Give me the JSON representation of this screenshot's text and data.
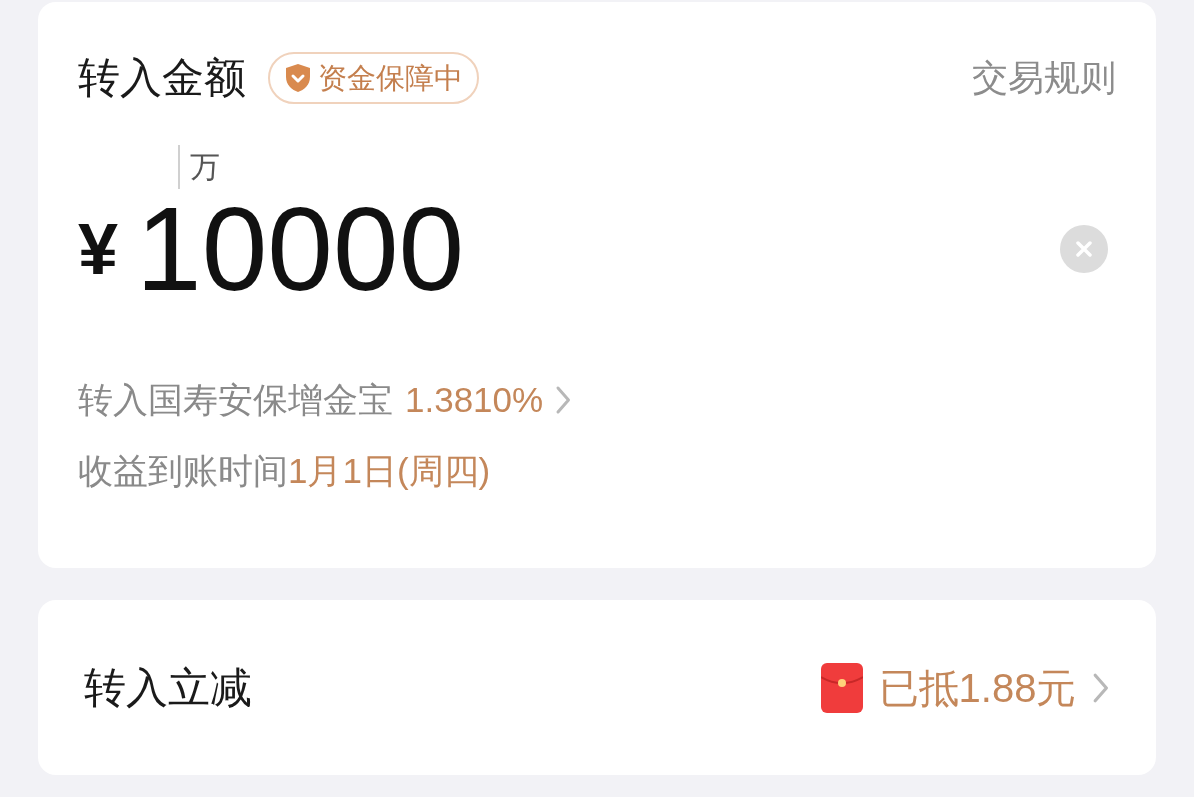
{
  "amount_card": {
    "title": "转入金额",
    "badge": "资金保障中",
    "rules_link": "交易规则",
    "unit_hint": "万",
    "currency": "¥",
    "amount": "10000",
    "fund_line": {
      "label": "转入国寿安保增金宝",
      "rate": "1.3810%"
    },
    "arrival_line": {
      "label": "收益到账时间",
      "date": "1月1日(周四)"
    }
  },
  "discount_card": {
    "title": "转入立减",
    "value": "已抵1.88元"
  }
}
